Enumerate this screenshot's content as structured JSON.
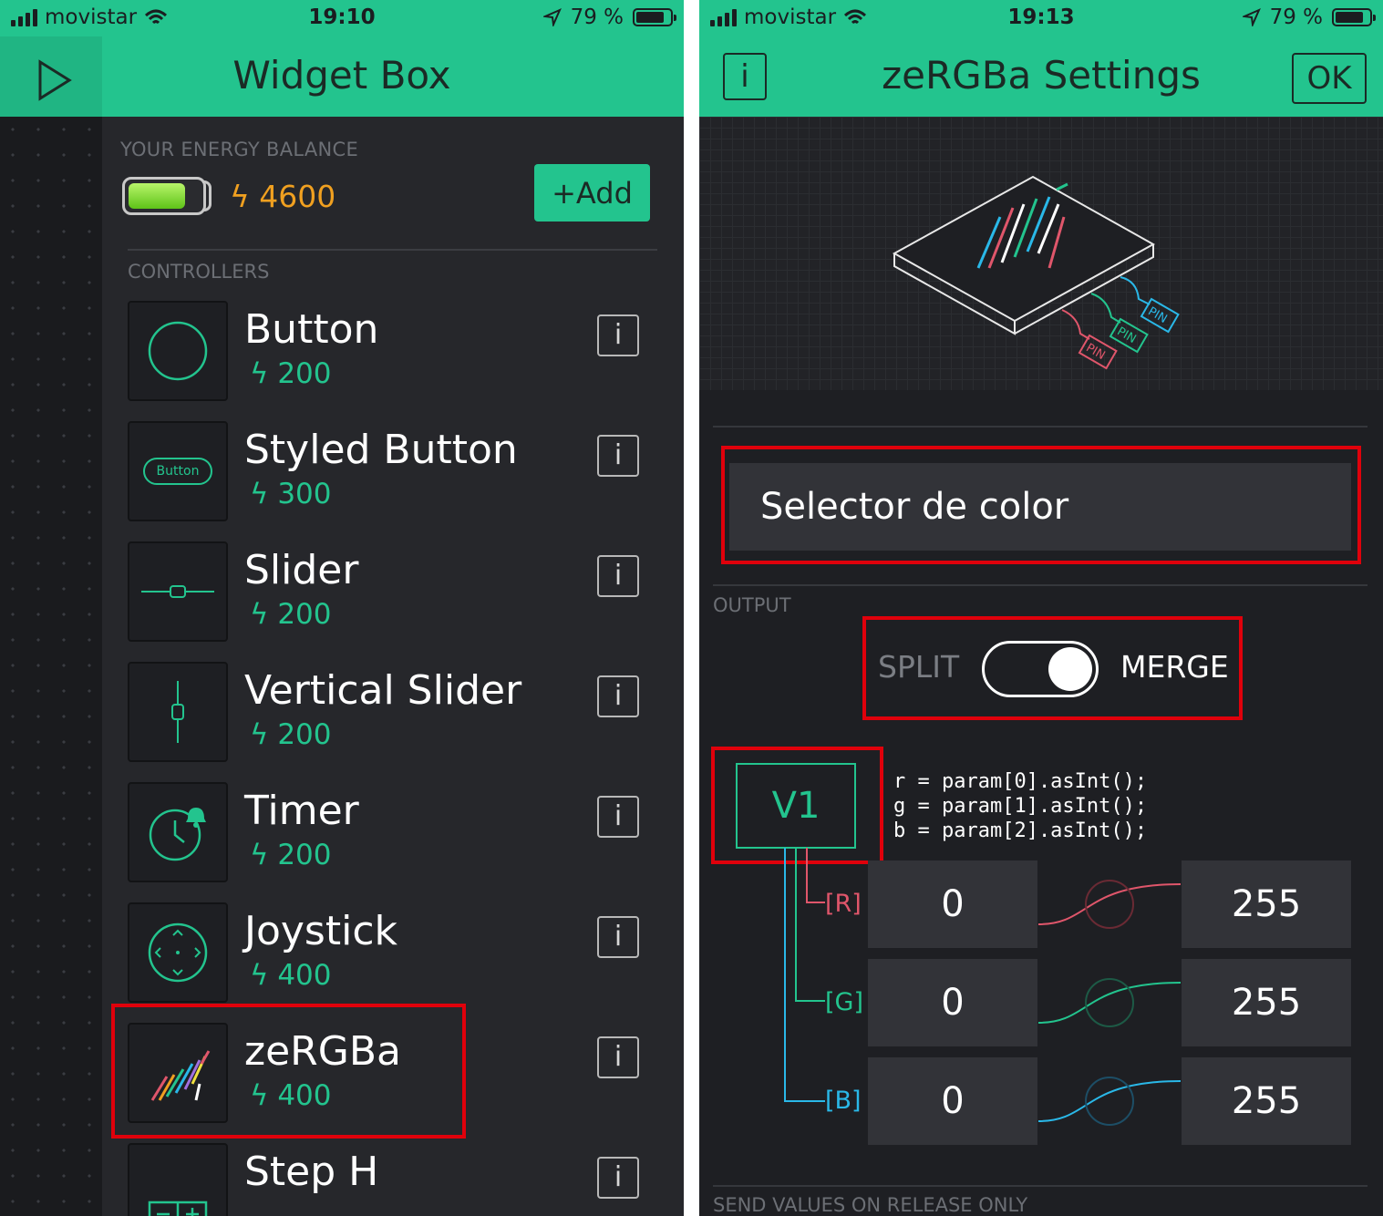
{
  "status_left": {
    "carrier": "movistar",
    "time": "19:10",
    "battery": "79 %"
  },
  "status_right": {
    "carrier": "movistar",
    "time": "19:13",
    "battery": "79 %"
  },
  "widget_box": {
    "title": "Widget Box",
    "energy_label": "YOUR ENERGY BALANCE",
    "energy_value": "4600",
    "add_label": "+Add",
    "section_label": "CONTROLLERS",
    "info_label": "i",
    "widgets": [
      {
        "name": "Button",
        "cost": "200",
        "icon": "circle-button-icon"
      },
      {
        "name": "Styled Button",
        "cost": "300",
        "icon": "styled-button-icon",
        "icon_text": "Button"
      },
      {
        "name": "Slider",
        "cost": "200",
        "icon": "horizontal-slider-icon"
      },
      {
        "name": "Vertical Slider",
        "cost": "200",
        "icon": "vertical-slider-icon"
      },
      {
        "name": "Timer",
        "cost": "200",
        "icon": "timer-clock-icon"
      },
      {
        "name": "Joystick",
        "cost": "400",
        "icon": "joystick-icon"
      },
      {
        "name": "zeRGBa",
        "cost": "400",
        "icon": "zebra-icon"
      },
      {
        "name": "Step H",
        "cost": "",
        "icon": "step-h-icon"
      }
    ]
  },
  "settings": {
    "title": "zeRGBa Settings",
    "info_label": "i",
    "ok_label": "OK",
    "widget_name": "Selector de color",
    "output_label": "OUTPUT",
    "split_label": "SPLIT",
    "merge_label": "MERGE",
    "merge_enabled": true,
    "pin": "V1",
    "code_lines": [
      "r = param[0].asInt();",
      "g = param[1].asInt();",
      "b = param[2].asInt();"
    ],
    "channels": [
      {
        "label": "[R]",
        "min": "0",
        "max": "255",
        "color": "#e0566b"
      },
      {
        "label": "[G]",
        "min": "0",
        "max": "255",
        "color": "#23c48e"
      },
      {
        "label": "[B]",
        "min": "0",
        "max": "255",
        "color": "#2ab8e8"
      }
    ],
    "pin_tags": [
      "PIN",
      "PIN",
      "PIN"
    ],
    "bottom_label": "SEND VALUES ON RELEASE ONLY"
  },
  "colors": {
    "accent": "#23c48e",
    "highlight": "#e0000b",
    "energy": "#f0a020"
  }
}
